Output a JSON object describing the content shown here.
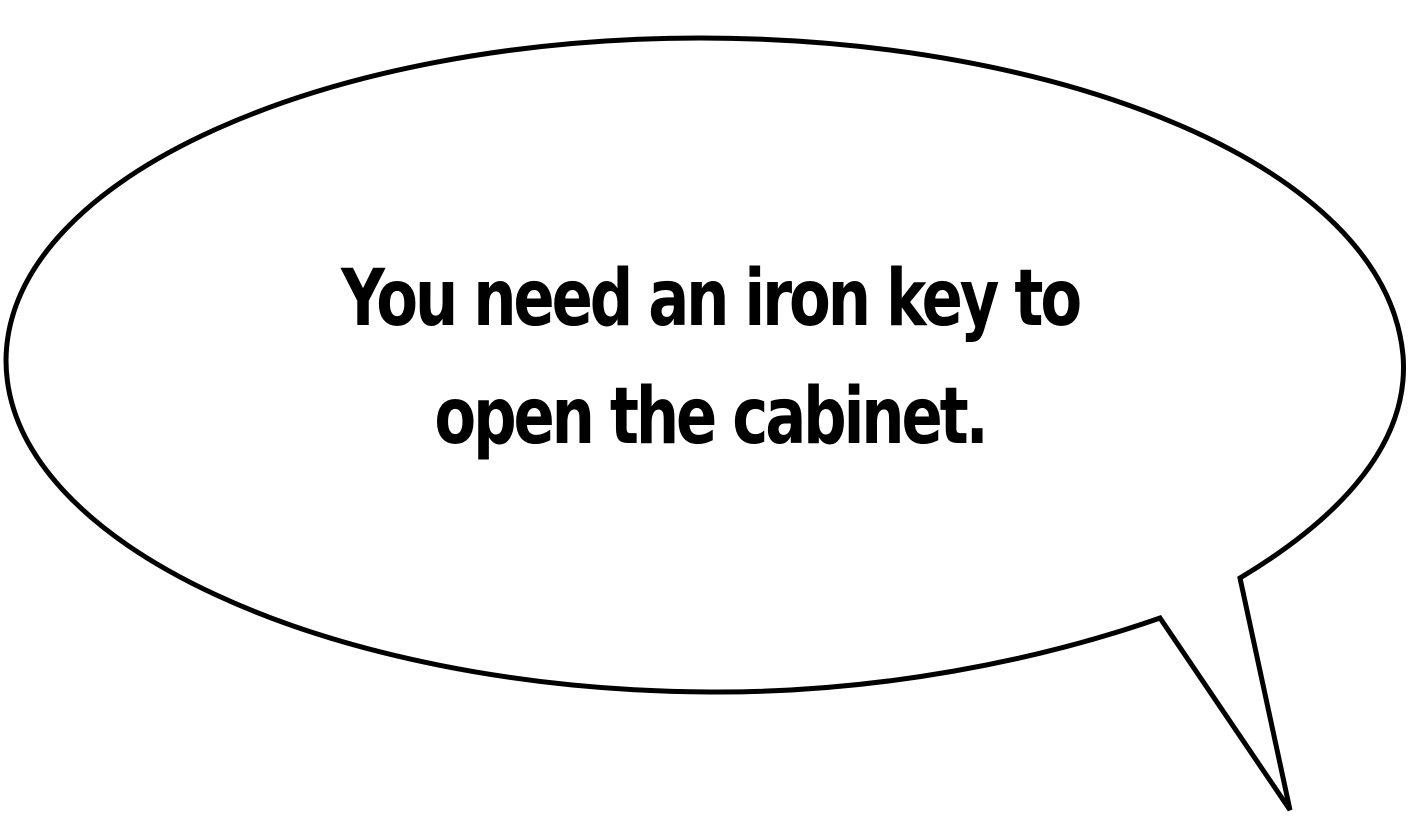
{
  "speech_bubble": {
    "lines": [
      "You need an iron key to",
      "open the cabinet."
    ],
    "text_color": "#000000",
    "fill_color": "#ffffff",
    "outline_color": "#000000"
  }
}
